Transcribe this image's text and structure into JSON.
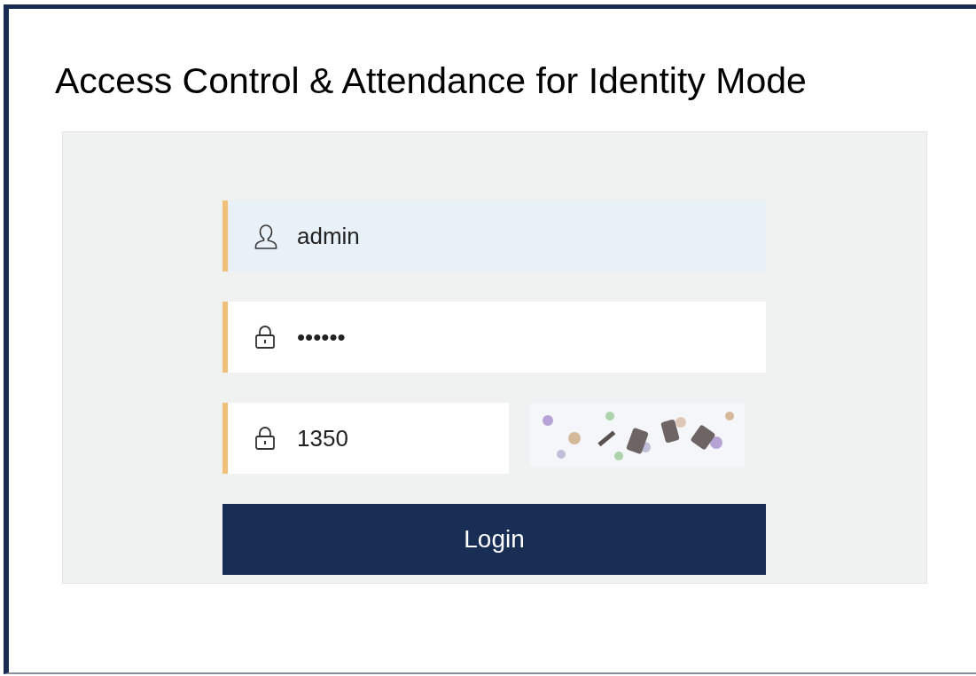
{
  "title": "Access Control & Attendance for Identity Mode",
  "fields": [
    {
      "kind": "user",
      "value": "admin",
      "highlighted": true
    },
    {
      "kind": "lock",
      "value": "••••••",
      "highlighted": false
    },
    {
      "kind": "lock",
      "value": "1350",
      "highlighted": false
    }
  ],
  "login_button": "Login"
}
